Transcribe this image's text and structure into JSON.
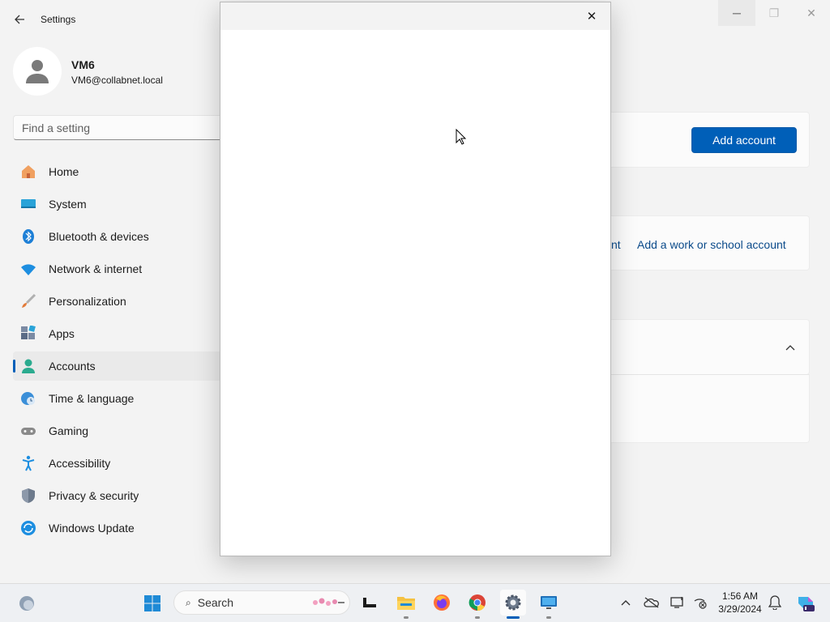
{
  "app": {
    "title": "Settings"
  },
  "window_controls": {
    "minimize": "─",
    "maximize": "❐",
    "close": "✕"
  },
  "profile": {
    "name": "VM6",
    "email": "VM6@collabnet.local"
  },
  "search": {
    "placeholder": "Find a setting"
  },
  "nav": {
    "items": [
      {
        "label": "Home",
        "icon": "home-icon"
      },
      {
        "label": "System",
        "icon": "system-icon"
      },
      {
        "label": "Bluetooth & devices",
        "icon": "bluetooth-icon"
      },
      {
        "label": "Network & internet",
        "icon": "wifi-icon"
      },
      {
        "label": "Personalization",
        "icon": "brush-icon"
      },
      {
        "label": "Apps",
        "icon": "apps-icon"
      },
      {
        "label": "Accounts",
        "icon": "accounts-icon",
        "active": true
      },
      {
        "label": "Time & language",
        "icon": "clock-globe-icon"
      },
      {
        "label": "Gaming",
        "icon": "gamepad-icon"
      },
      {
        "label": "Accessibility",
        "icon": "accessibility-icon"
      },
      {
        "label": "Privacy & security",
        "icon": "shield-icon"
      },
      {
        "label": "Windows Update",
        "icon": "update-icon"
      }
    ]
  },
  "content": {
    "add_account_label": "Add account",
    "partial_link": "nt",
    "work_account_link": "Add a work or school account"
  },
  "dialog": {
    "close": "✕"
  },
  "taskbar": {
    "search_label": "Search",
    "clock_time": "1:56 AM",
    "clock_date": "3/29/2024"
  },
  "colors": {
    "accent": "#005fb8",
    "background": "#f3f3f3"
  }
}
